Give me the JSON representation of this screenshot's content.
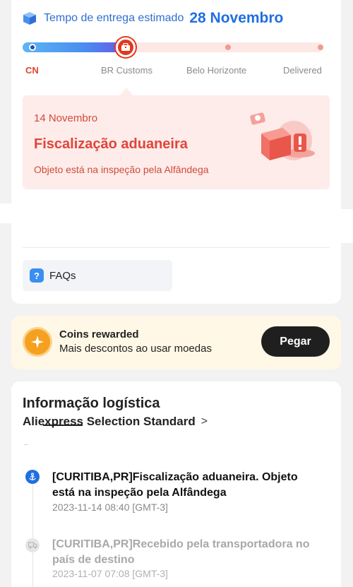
{
  "eta": {
    "label": "Tempo de entrega estimado",
    "date": "28 Novembro"
  },
  "progress": {
    "stages": [
      "CN",
      "BR Customs",
      "Belo Horizonte",
      "Delivered"
    ],
    "current_stage_index": 1
  },
  "status": {
    "date": "14 Novembro",
    "title": "Fiscalização aduaneira",
    "description": "Objeto está na inspeção pela Alfândega"
  },
  "faq": {
    "icon": "question-icon",
    "label": "FAQs"
  },
  "coins": {
    "title": "Coins rewarded",
    "subtitle": "Mais descontos ao usar moedas",
    "button": "Pegar"
  },
  "logistics": {
    "title": "Informação logística",
    "carrier": "Aliexpress Selection Standard",
    "events": [
      {
        "line1": "[CURITIBA,PR]Fiscalização aduaneira. Objeto",
        "line2": "está na inspeção pela Alfândega",
        "time": "2023-11-14 08:40 [GMT-3]",
        "state": "current"
      },
      {
        "line1": "[CURITIBA,PR]Recebido pela transportadora no",
        "line2": "país de destino",
        "time": "2023-11-07 07:08 [GMT-3]",
        "state": "past"
      }
    ]
  },
  "colors": {
    "accent_blue": "#1f6fe0",
    "accent_red": "#e0453a",
    "status_bg": "#fdecea",
    "coins_bg": "#fff8e6"
  }
}
